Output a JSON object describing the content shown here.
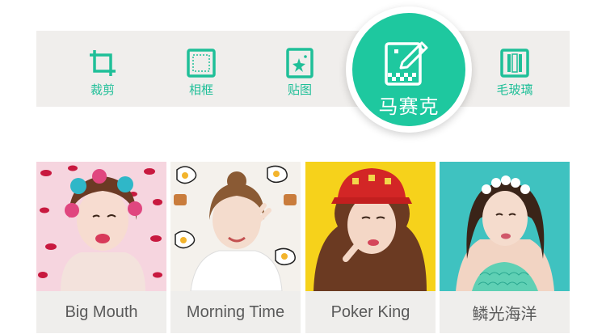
{
  "toolbar": {
    "items": [
      {
        "label": "裁剪",
        "icon": "crop-icon"
      },
      {
        "label": "相框",
        "icon": "frame-icon"
      },
      {
        "label": "贴图",
        "icon": "sticker-icon"
      },
      {
        "label": "毛玻璃",
        "icon": "frosted-glass-icon"
      }
    ],
    "active": {
      "label": "马赛克",
      "icon": "mosaic-pencil-icon"
    }
  },
  "filters": [
    {
      "label": "Big Mouth"
    },
    {
      "label": "Morning Time"
    },
    {
      "label": "Poker King"
    },
    {
      "label": "鳞光海洋"
    }
  ],
  "colors": {
    "accent": "#1ec89f",
    "label_text": "#1fbf98",
    "strip_bg": "#f0eeec",
    "card_bg": "#efeeec",
    "caption_text": "#5a5a5a"
  }
}
